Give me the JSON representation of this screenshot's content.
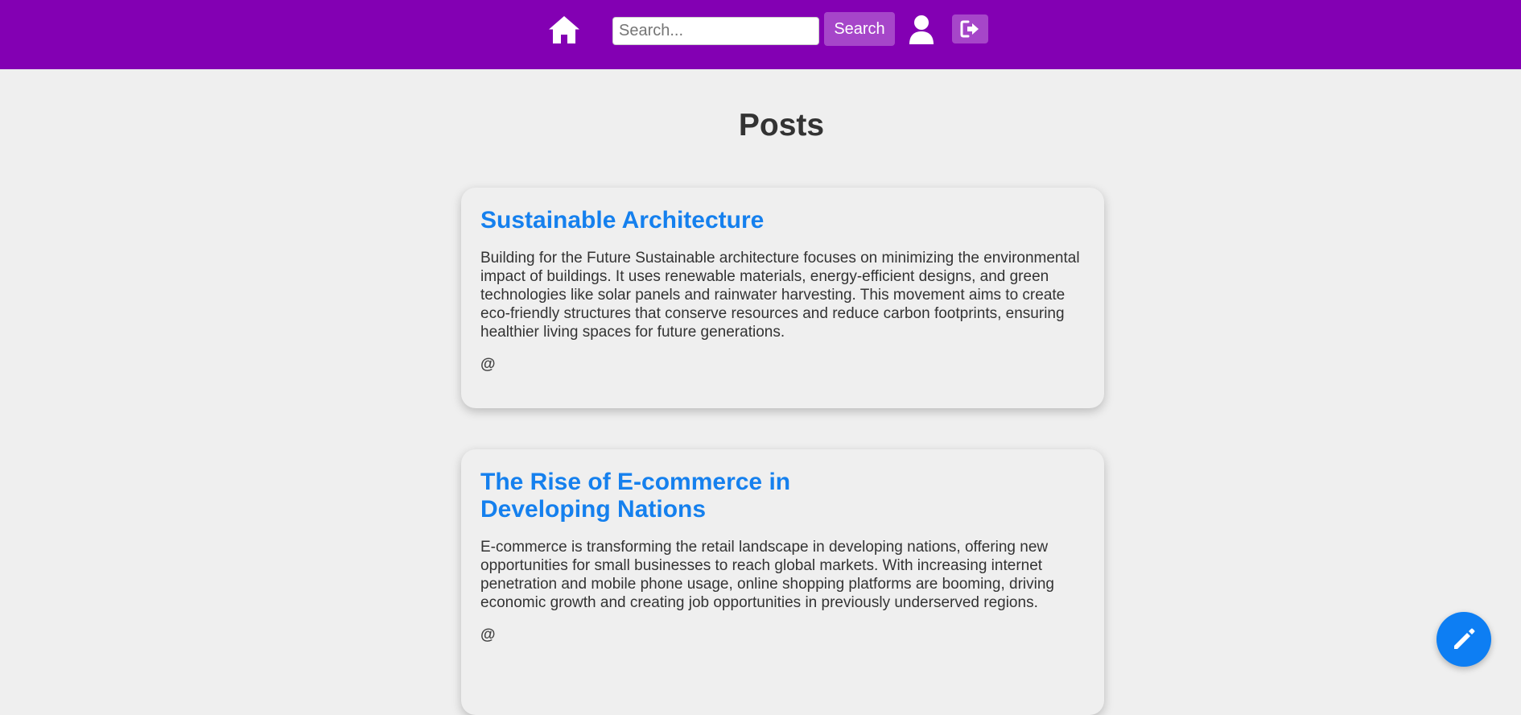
{
  "nav": {
    "home_icon": "home-icon",
    "search_placeholder": "Search...",
    "search_value": "",
    "search_button": "Search",
    "profile_icon": "user-icon",
    "logout_icon": "sign-out-icon",
    "background_color": "#8300b3",
    "button_color": "#a646c9"
  },
  "main": {
    "title": "Posts",
    "posts": [
      {
        "title": "Sustainable Architecture",
        "body": "Building for the Future Sustainable architecture focuses on minimizing the environmental impact of buildings. It uses renewable materials, energy-efficient designs, and green technologies like solar panels and rainwater harvesting. This movement aims to create eco-friendly structures that conserve resources and reduce carbon footprints, ensuring healthier living spaces for future generations.",
        "author": "@"
      },
      {
        "title": "The Rise of E-commerce in Developing Nations",
        "body": "E-commerce is transforming the retail landscape in developing nations, offering new opportunities for small businesses to reach global markets. With increasing internet penetration and mobile phone usage, online shopping platforms are booming, driving economic growth and creating job opportunities in previously underserved regions.",
        "author": "@"
      }
    ],
    "title_color": "#1580ee"
  },
  "fab": {
    "icon": "pencil-icon",
    "color": "#0d7ef3"
  }
}
